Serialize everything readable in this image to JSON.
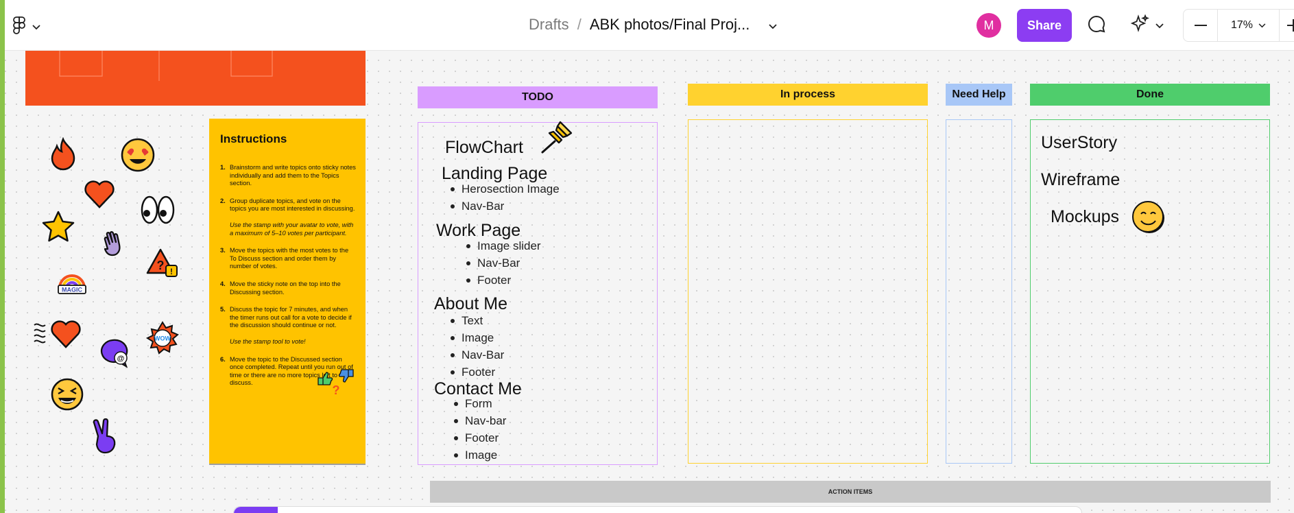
{
  "toolbar": {
    "breadcrumb_root": "Drafts",
    "breadcrumb_separator": "/",
    "file_title": "ABK photos/Final Proj...",
    "avatar_initial": "M",
    "share_label": "Share",
    "zoom_level": "17%"
  },
  "colors": {
    "share": "#8c3df2",
    "avatar": "#e02fa0",
    "instructions_bg": "#ffc300",
    "banner": "#f4511e",
    "todo": "#d99cff",
    "in_process": "#ffd22f",
    "need_help": "#a8c7f7",
    "done": "#4fcd6c"
  },
  "instructions": {
    "title": "Instructions",
    "items": [
      {
        "num": "1.",
        "text": "Brainstorm and write topics onto sticky notes individually and add them to the Topics section.",
        "note": ""
      },
      {
        "num": "2.",
        "text": "Group duplicate topics, and vote on the topics you are most interested in discussing.",
        "note": "Use the stamp with your avatar to vote, with a maximum of 5–10 votes per participant."
      },
      {
        "num": "3.",
        "text": "Move the topics with the most votes to the To Discuss section and order them by number of votes.",
        "note": ""
      },
      {
        "num": "4.",
        "text": "Move the sticky note on the top into the Discussing section.",
        "note": ""
      },
      {
        "num": "5.",
        "text": "Discuss the topic for 7 minutes, and when the timer runs out call for a vote to decide if the discussion should continue or not.",
        "note": "Use the stamp tool to vote!"
      },
      {
        "num": "6.",
        "text": "Move the topic to the Discussed section once completed. Repeat until you run out of time or there are no more topics left to discuss.",
        "note": ""
      }
    ]
  },
  "columns": {
    "todo": "TODO",
    "in_process": "In process",
    "need_help": "Need Help",
    "done": "Done"
  },
  "todo_items": {
    "flowchart": "FlowChart",
    "landing": "Landing Page",
    "landing_1": "Herosection Image",
    "landing_2": "Nav-Bar",
    "work": "Work Page",
    "work_1": "Image slider",
    "work_2": "Nav-Bar",
    "work_3": "Footer",
    "about": "About Me",
    "about_1": "Text",
    "about_2": "Image",
    "about_3": "Nav-Bar",
    "about_4": "Footer",
    "contact": "Contact Me",
    "contact_1": "Form",
    "contact_2": "Nav-bar",
    "contact_3": "Footer",
    "contact_4": "Image"
  },
  "done_items": {
    "item_1": "UserStory",
    "item_2": "Wireframe",
    "item_3": "Mockups"
  },
  "stickers": {
    "magic_label": "MAGIC",
    "wow_label": "WOW"
  },
  "action_items": "ACTION ITEMS"
}
